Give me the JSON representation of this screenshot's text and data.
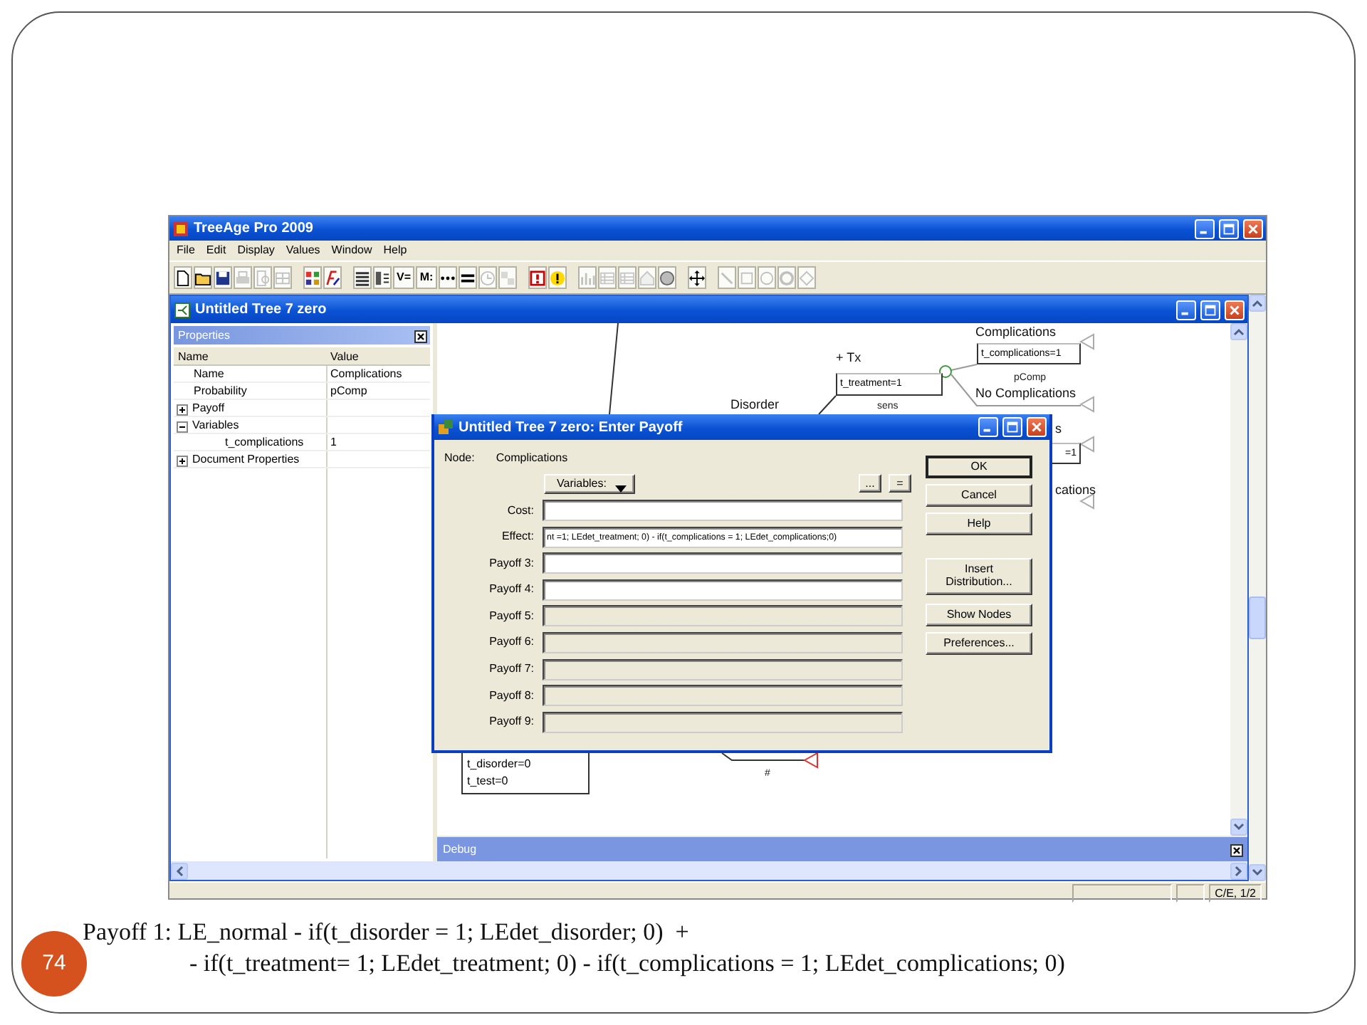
{
  "slide": {
    "number": "74",
    "caption_lines": [
      "Payoff 1: LE_normal - if(t_disorder = 1; LEdet_disorder; 0)  +",
      "- if(t_treatment= 1; LEdet_treatment; 0) - if(t_complications = 1; LEdet_complications; 0)"
    ]
  },
  "app": {
    "title": "TreeAge Pro 2009",
    "menu": [
      "File",
      "Edit",
      "Display",
      "Values",
      "Window",
      "Help"
    ],
    "toolbar": [
      {
        "kind": "new",
        "disabled": false
      },
      {
        "kind": "open",
        "disabled": false
      },
      {
        "kind": "save",
        "disabled": false
      },
      {
        "kind": "print",
        "disabled": true
      },
      {
        "kind": "preview",
        "disabled": true
      },
      {
        "kind": "tile",
        "disabled": true
      },
      {
        "kind": "separator"
      },
      {
        "kind": "yn",
        "disabled": false
      },
      {
        "kind": "fx",
        "disabled": false
      },
      {
        "kind": "separator"
      },
      {
        "kind": "tree",
        "disabled": false
      },
      {
        "kind": "stat",
        "disabled": false
      },
      {
        "kind": "glyph",
        "text": "V=",
        "disabled": false
      },
      {
        "kind": "glyph",
        "text": "M:",
        "disabled": false
      },
      {
        "kind": "dots",
        "disabled": false
      },
      {
        "kind": "equals",
        "disabled": false
      },
      {
        "kind": "clock",
        "disabled": true
      },
      {
        "kind": "gear",
        "disabled": true
      },
      {
        "kind": "separator"
      },
      {
        "kind": "help",
        "disabled": false
      },
      {
        "kind": "warning",
        "disabled": false
      },
      {
        "kind": "separator"
      },
      {
        "kind": "chart",
        "disabled": true
      },
      {
        "kind": "table",
        "disabled": true
      },
      {
        "kind": "table",
        "disabled": true
      },
      {
        "kind": "house",
        "disabled": true
      },
      {
        "kind": "sphere",
        "disabled": false
      },
      {
        "kind": "separator"
      },
      {
        "kind": "move",
        "disabled": false
      },
      {
        "kind": "separator"
      },
      {
        "kind": "arrow",
        "disabled": true
      },
      {
        "kind": "square",
        "disabled": true
      },
      {
        "kind": "circle",
        "disabled": true
      },
      {
        "kind": "ring",
        "disabled": true
      },
      {
        "kind": "diamond",
        "disabled": true
      }
    ],
    "document": {
      "title": "Untitled Tree 7 zero"
    },
    "properties": {
      "title": "Properties",
      "columns": [
        "Name",
        "Value"
      ],
      "rows": [
        {
          "name": "Name",
          "value": "Complications"
        },
        {
          "name": "Probability",
          "value": "pComp"
        },
        {
          "name": "Payoff",
          "expanded": false
        },
        {
          "name": "Variables",
          "expanded": true,
          "children": [
            {
              "name": "t_complications",
              "value": "1"
            }
          ]
        },
        {
          "name": "Document Properties",
          "expanded": false
        }
      ]
    },
    "tree": {
      "items": [
        {
          "kind": "label",
          "text": "Complications"
        },
        {
          "kind": "box",
          "text": "t_complications=1"
        },
        {
          "kind": "prob",
          "text": "pComp"
        },
        {
          "kind": "label",
          "text": "No Complications"
        },
        {
          "kind": "label",
          "text": "+ Tx"
        },
        {
          "kind": "box",
          "text": "t_treatment=1"
        },
        {
          "kind": "prob",
          "text": "sens"
        },
        {
          "kind": "label",
          "text": "Disorder"
        },
        {
          "kind": "label",
          "text": "s"
        },
        {
          "kind": "box",
          "text": "=1"
        },
        {
          "kind": "label",
          "text": "cations"
        },
        {
          "kind": "list_box",
          "lines": [
            "t_disorder=0",
            "t_test=0"
          ]
        },
        {
          "kind": "prob",
          "text": "#"
        }
      ]
    },
    "dialog": {
      "title": "Untitled Tree 7 zero: Enter Payoff",
      "node_label": "Node:",
      "node": "Complications",
      "variables_button": "Variables:",
      "small_buttons": [
        "...",
        "="
      ],
      "fields": [
        {
          "label": "Cost:",
          "disabled": false
        },
        {
          "label": "Effect:",
          "value": "nt =1; LEdet_treatment; 0) - if(t_complications = 1; LEdet_complications;0)",
          "disabled": false
        },
        {
          "label": "Payoff 3:",
          "disabled": false
        },
        {
          "label": "Payoff 4:",
          "disabled": false
        },
        {
          "label": "Payoff 5:",
          "disabled": true
        },
        {
          "label": "Payoff 6:",
          "disabled": true
        },
        {
          "label": "Payoff 7:",
          "disabled": true
        },
        {
          "label": "Payoff 8:",
          "disabled": true
        },
        {
          "label": "Payoff 9:",
          "disabled": true
        }
      ],
      "buttons": [
        {
          "label": "OK",
          "default": true
        },
        {
          "label": "Cancel",
          "default": false
        },
        {
          "label": "Help",
          "default": false
        },
        {
          "label": "Insert Distribution...",
          "default": false
        },
        {
          "label": "Show Nodes",
          "default": false
        },
        {
          "label": "Preferences...",
          "default": false
        }
      ]
    },
    "debug": {
      "title": "Debug"
    },
    "status_bar": {
      "mode": "C/E, 1/2"
    }
  }
}
